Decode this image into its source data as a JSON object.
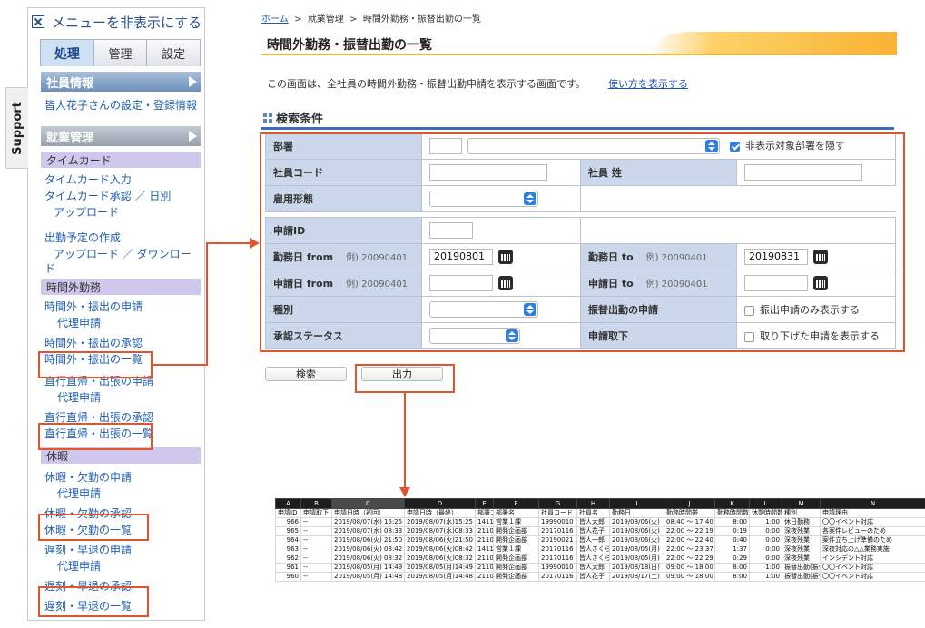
{
  "sidebar": {
    "toggle_label": "メニューを非表示にする",
    "tabs": [
      {
        "label": "処理"
      },
      {
        "label": "管理"
      },
      {
        "label": "設定"
      }
    ],
    "employee_section": "社員情報",
    "employee_link": "皆人花子さんの設定・登録情報",
    "work_section": "就業管理",
    "timecard_head": "タイムカード",
    "timecard_links": [
      "タイムカード入力",
      "タイムカード承認 ／ 日別",
      "アップロード",
      "出勤予定の作成",
      "アップロード ／ ダウンロー",
      "ド"
    ],
    "overtime_head": "時間外勤務",
    "overtime_links": [
      "時間外・振出の申請",
      "代理申請",
      "時間外・振出の承認",
      "時間外・振出の一覧",
      "直行直帰・出張の申請",
      "代理申請",
      "直行直帰・出張の承認",
      "直行直帰・出張の一覧"
    ],
    "leave_head": "休暇",
    "leave_links": [
      "休暇・欠勤の申請",
      "代理申請",
      "休暇・欠勤の承認",
      "休暇・欠勤の一覧",
      "遅刻・早退の申請",
      "代理申請",
      "遅刻・早退の承認",
      "遅刻・早退の一覧"
    ]
  },
  "support_tab": "Support",
  "breadcrumb": {
    "home": "ホーム",
    "sep": ">",
    "level2": "就業管理",
    "level3": "時間外勤務・振替出勤の一覧"
  },
  "page_title": "時間外勤務・振替出勤の一覧",
  "description": "この画面は、全社員の時間外勤務・振替出勤申請を表示する画面です。",
  "usage_link": "使い方を表示する",
  "conditions_title": "検索条件",
  "form": {
    "dept_label": "部署",
    "hide_dept_label": "非表示対象部署を隠す",
    "hide_dept_checked": true,
    "emp_code_label": "社員コード",
    "emp_name_label": "社員 姓",
    "employment_type_label": "雇用形態",
    "request_id_label": "申請ID",
    "work_from_label": "勤務日 from",
    "work_from_example": "例) 20090401",
    "work_from_value": "20190801",
    "work_to_label": "勤務日 to",
    "work_to_example": "例) 20090401",
    "work_to_value": "20190831",
    "req_from_label": "申請日 from",
    "req_from_example": "例) 20090401",
    "req_to_label": "申請日 to",
    "req_to_example": "例) 20090401",
    "type_label": "種別",
    "substitute_label": "振替出勤の申請",
    "substitute_only_label": "振出申請のみ表示する",
    "approval_status_label": "承認ステータス",
    "withdraw_label": "申請取下",
    "withdraw_show_label": "取り下げた申請を表示する"
  },
  "buttons": {
    "search": "検索",
    "output": "出力"
  },
  "excel": {
    "col_letters": [
      "A",
      "B",
      "C",
      "D",
      "E",
      "F",
      "G",
      "H",
      "I",
      "J",
      "K",
      "L",
      "M",
      "N"
    ],
    "headers": [
      "申請ID",
      "申請取下",
      "申請日時（初回）",
      "申請日時（最終）",
      "部署コード",
      "部署名",
      "社員コード",
      "社員名",
      "勤務日",
      "勤務時間帯",
      "勤務時間数",
      "休憩時間数",
      "種別",
      "申請理由"
    ],
    "rows": [
      [
        "966",
        "--",
        "2019/08/07(水) 15:25",
        "2019/08/07(水)15:25",
        "1411",
        "営業１課",
        "19990010",
        "皆人太郎",
        "2019/08/06(火)",
        "08:40 〜 17:40",
        "8:00",
        "1:00",
        "休日勤務",
        "〇〇イベント対応"
      ],
      [
        "965",
        "--",
        "2019/08/07(水) 08:33",
        "2019/08/07(水)08:33",
        "2110",
        "開発企画部",
        "20170116",
        "皆人花子",
        "2019/08/06(火)",
        "22:00 〜 22:19",
        "0:19",
        "0:00",
        "深夜残業",
        "各案件レビューのため"
      ],
      [
        "964",
        "--",
        "2019/08/06(火) 21:50",
        "2019/08/06(火)21:50",
        "2110",
        "開発企画部",
        "20190021",
        "皆人一郎",
        "2019/08/06(火)",
        "22:00 〜 22:40",
        "0:40",
        "0:00",
        "深夜残業",
        "案件立ち上げ準備のため"
      ],
      [
        "963",
        "--",
        "2019/08/06(火) 08:42",
        "2019/08/06(火)08:42",
        "1411",
        "営業１課",
        "20170116",
        "皆人さくら",
        "2019/08/05(月)",
        "22:00 〜 23:37",
        "1:37",
        "0:00",
        "深夜残業",
        "深夜対応の△△業務実施"
      ],
      [
        "962",
        "--",
        "2019/08/06(火) 08:32",
        "2019/08/06(火)08:32",
        "2110",
        "開発企画部",
        "20170116",
        "皆人さくら",
        "2019/08/05(月)",
        "22:00 〜 22:29",
        "0:29",
        "0:00",
        "深夜残業",
        "インシデント対応"
      ],
      [
        "961",
        "--",
        "2019/08/05(月) 14:49",
        "2019/08/05(月)14:49",
        "2110",
        "開発企画部",
        "19990010",
        "皆人太郎",
        "2019/08/18(日)",
        "09:00 〜 18:00",
        "8:00",
        "1:00",
        "振替出勤(振休)",
        "〇〇イベント対応"
      ],
      [
        "960",
        "--",
        "2019/08/05(月) 14:48",
        "2019/08/05(月)14:48",
        "2110",
        "開発企画部",
        "20170116",
        "皆人花子",
        "2019/08/17(土)",
        "09:00 〜 18:00",
        "8:00",
        "1:00",
        "振替出勤(振休)",
        "〇〇イベント対応"
      ]
    ]
  },
  "colors": {
    "accent_link": "#1f5fb0",
    "highlight": "#e0552f",
    "form_label_bg": "#cbd7ea",
    "title_swoosh": "#f9b233"
  }
}
